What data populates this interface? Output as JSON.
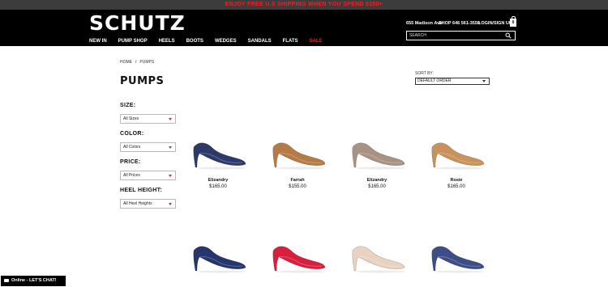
{
  "promo": "ENJOY FREE U.S SHIPPING WHEN YOU SPEND $150+",
  "header": {
    "logo": "SCHUTZ",
    "address": "655 Madison Ave",
    "phone": "SHOP 646 561-3550",
    "login": "LOGIN/SIGN UP",
    "bag_count": "0",
    "search_placeholder": "SEARCH",
    "nav": [
      "NEW IN",
      "PUMP SHOP",
      "HEELS",
      "BOOTS",
      "WEDGES",
      "SANDALS",
      "FLATS",
      "SALE"
    ]
  },
  "breadcrumb": [
    "HOME",
    "/",
    "PUMPS"
  ],
  "page_title": "PUMPS",
  "sort": {
    "label": "SORT BY",
    "value": "DEFAULT ORDER"
  },
  "filters": [
    {
      "label": "SIZE:",
      "value": "All Sizes"
    },
    {
      "label": "COLOR:",
      "value": "All Colors"
    },
    {
      "label": "PRICE:",
      "value": "All Prices"
    },
    {
      "label": "HEEL HEIGHT:",
      "value": "All Heel Heights"
    }
  ],
  "products": [
    {
      "name": "Elizandry",
      "price": "$165.00",
      "color": "#2c3a6b"
    },
    {
      "name": "Farrah",
      "price": "$155.00",
      "color": "#b57a45"
    },
    {
      "name": "Elizandry",
      "price": "$165.00",
      "color": "#a89282"
    },
    {
      "name": "Rosie",
      "price": "$165.00",
      "color": "#c8925a"
    },
    {
      "name": "",
      "price": "",
      "color": "#26356b"
    },
    {
      "name": "",
      "price": "",
      "color": "#d81f3e"
    },
    {
      "name": "",
      "price": "",
      "color": "#e9d2bf"
    },
    {
      "name": "",
      "price": "",
      "color": "#3d4d86"
    }
  ],
  "chat": "Online - LET'S CHAT!",
  "colors": {
    "promo_text": "#e8222a",
    "sale": "#e8222a",
    "header_bg": "#000000"
  }
}
